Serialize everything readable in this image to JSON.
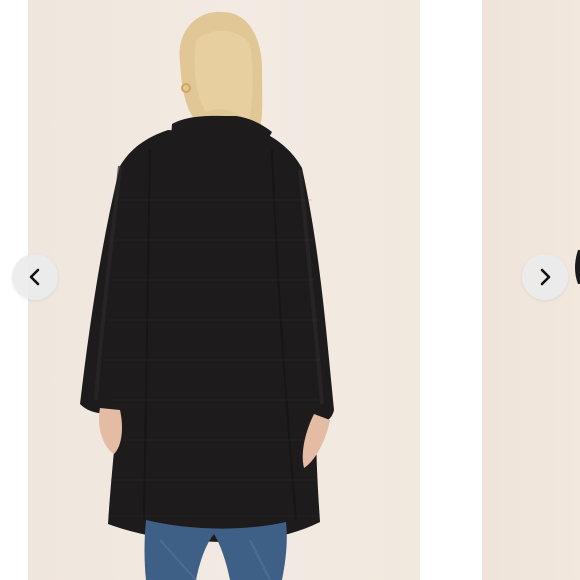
{
  "carousel": {
    "prev_icon": "chevron-left-icon",
    "next_icon": "chevron-right-icon",
    "main_photo": "model-back-view-black-long-cardigan",
    "next_photo": "partial-next-product-photo"
  },
  "colors": {
    "backdrop": "#f1e8de",
    "garment": "#1d1b1c",
    "hair": "#e1c796",
    "denim": "#3e5f86",
    "nav_button": "#ebebeb",
    "chevron": "#111111"
  }
}
